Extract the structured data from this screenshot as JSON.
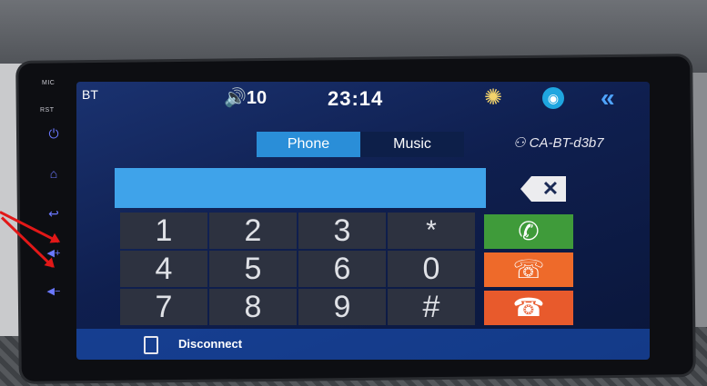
{
  "side_panel": {
    "mic_label": "MIC",
    "rst_label": "RST",
    "buttons": [
      {
        "name": "power-icon",
        "glyph": "⏻"
      },
      {
        "name": "home-icon",
        "glyph": "⌂"
      },
      {
        "name": "back-icon",
        "glyph": "↩"
      },
      {
        "name": "volume-up-icon",
        "glyph": "◀+"
      },
      {
        "name": "volume-down-icon",
        "glyph": "◀−"
      }
    ]
  },
  "status_bar": {
    "bt_label": "BT",
    "volume": "10",
    "volume_icon": "speaker-icon",
    "time": "23:14",
    "brightness_icon": "sun-icon",
    "app_icon": "circle-app-icon",
    "back_icon": "double-chevron-left-icon"
  },
  "tabs": [
    {
      "label": "Phone",
      "active": true
    },
    {
      "label": "Music",
      "active": false
    }
  ],
  "device_name": "CA-BT-d3b7",
  "dial_display": "",
  "keypad": [
    [
      "1",
      "2",
      "3",
      "*"
    ],
    [
      "4",
      "5",
      "6",
      "0"
    ],
    [
      "7",
      "8",
      "9",
      "#"
    ]
  ],
  "actions": [
    {
      "name": "call-button",
      "icon": "phone-icon",
      "color": "#3f9b3a"
    },
    {
      "name": "transfer-button",
      "icon": "phone-transfer-icon",
      "color": "#ee6a2a"
    },
    {
      "name": "hangup-button",
      "icon": "hangup-icon",
      "color": "#e85a2c"
    }
  ],
  "bottom_bar": {
    "disconnect_label": "Disconnect"
  },
  "colors": {
    "tab_active": "#2a8ed8",
    "display": "#3fa3ea",
    "call_green": "#3f9b3a",
    "orange": "#ee6a2a",
    "side_buttons": "#6a78ff"
  }
}
